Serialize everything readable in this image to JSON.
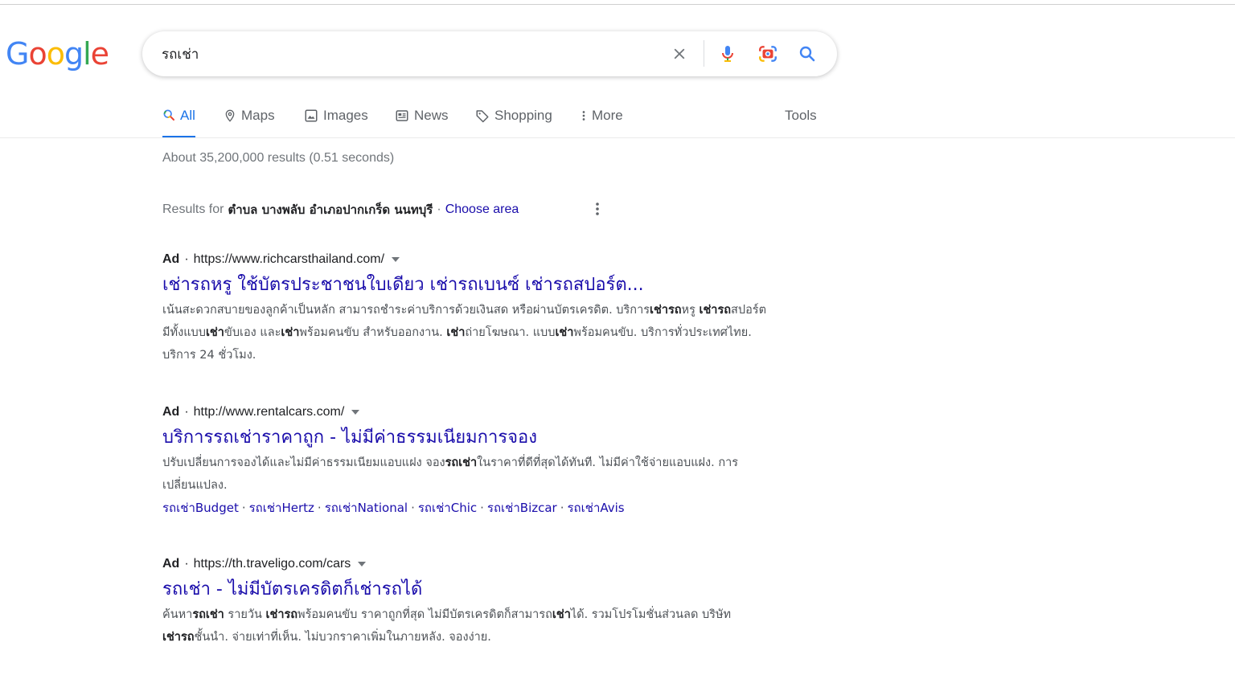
{
  "colors": {
    "link": "#1a0dab",
    "accent": "#1a73e8",
    "muted": "#70757a",
    "text": "#202124"
  },
  "logo": {
    "letters": [
      "G",
      "o",
      "o",
      "g",
      "l",
      "e"
    ],
    "colors": [
      "#4285F4",
      "#EA4335",
      "#FBBC05",
      "#4285F4",
      "#34A853",
      "#EA4335"
    ]
  },
  "search": {
    "query": "รถเช่า",
    "icons": [
      "close-icon",
      "mic-icon",
      "camera-lens-icon",
      "search-icon"
    ]
  },
  "tabs": [
    {
      "label": "All",
      "icon": "search-icon"
    },
    {
      "label": "Maps",
      "icon": "pin-icon"
    },
    {
      "label": "Images",
      "icon": "image-icon"
    },
    {
      "label": "News",
      "icon": "news-icon"
    },
    {
      "label": "Shopping",
      "icon": "tag-icon"
    },
    {
      "label": "More",
      "icon": "more-vert-icon"
    }
  ],
  "tools_label": "Tools",
  "result_stats": "About 35,200,000 results (0.51 seconds)",
  "location": {
    "prefix": "Results for",
    "place": "ตำบล บางพลับ อำเภอปากเกร็ด นนทบุรี",
    "separator": "·",
    "link": "Choose area"
  },
  "ads": [
    {
      "label": "Ad",
      "dot": "·",
      "url": "https://www.richcarsthailand.com/",
      "title": "เช่ารถหรู ใช้บัตรประชาชนใบเดียว เช่ารถเบนซ์ เช่ารถสปอร์ต...",
      "desc": [
        {
          "t": "เน้นสะดวกสบายของลูกค้าเป็นหลัก สามารถชำระค่าบริการด้วยเงินสด หรือผ่านบัตรเครดิต. บริการ"
        },
        {
          "t": "เช่ารถ",
          "b": true
        },
        {
          "t": "หรู "
        },
        {
          "t": "เช่ารถ",
          "b": true
        },
        {
          "t": "สปอร์ต มีทั้งแบบ"
        },
        {
          "t": "เช่า",
          "b": true
        },
        {
          "t": "ขับเอง และ"
        },
        {
          "t": "เช่า",
          "b": true
        },
        {
          "t": "พร้อมคนขับ สำหรับออกงาน. "
        },
        {
          "t": "เช่า",
          "b": true
        },
        {
          "t": "ถ่ายโฆษณา. แบบ"
        },
        {
          "t": "เช่า",
          "b": true
        },
        {
          "t": "พร้อมคนขับ. บริการทั่วประเทศไทย. บริการ 24 ชั่วโมง."
        }
      ],
      "sitelinks": []
    },
    {
      "label": "Ad",
      "dot": "·",
      "url": "http://www.rentalcars.com/",
      "title": "บริการรถเช่าราคาถูก - ไม่มีค่าธรรมเนียมการจอง",
      "desc": [
        {
          "t": "ปรับเปลี่ยนการจองได้และไม่มีค่าธรรมเนียมแอบแฝง จอง"
        },
        {
          "t": "รถเช่า",
          "b": true
        },
        {
          "t": "ในราคาที่ดีที่สุดได้ทันที. ไม่มีค่าใช้จ่ายแอบแฝง. การเปลี่ยนแปลง."
        }
      ],
      "sitelinks": [
        "รถเช่าBudget",
        "รถเช่าHertz",
        "รถเช่าNational",
        "รถเช่าChic",
        "รถเช่าBizcar",
        "รถเช่าAvis"
      ],
      "sitelink_separator": "·"
    },
    {
      "label": "Ad",
      "dot": "·",
      "url": "https://th.traveligo.com/cars",
      "title": "รถเช่า - ไม่มีบัตรเครดิตก็เช่ารถได้",
      "desc": [
        {
          "t": "ค้นหา"
        },
        {
          "t": "รถเช่า",
          "b": true
        },
        {
          "t": " รายวัน "
        },
        {
          "t": "เช่ารถ",
          "b": true
        },
        {
          "t": "พร้อมคนขับ ราคาถูกที่สุด ไม่มีบัตรเครดิตก็สามารถ"
        },
        {
          "t": "เช่า",
          "b": true
        },
        {
          "t": "ได้. รวมโปรโมชั่นส่วนลด บริษัท"
        },
        {
          "t": "เช่ารถ",
          "b": true
        },
        {
          "t": "ชั้นนำ. จ่ายเท่าที่เห็น. ไม่บวกราคาเพิ่มในภายหลัง. จองง่าย."
        }
      ],
      "sitelinks": []
    }
  ]
}
